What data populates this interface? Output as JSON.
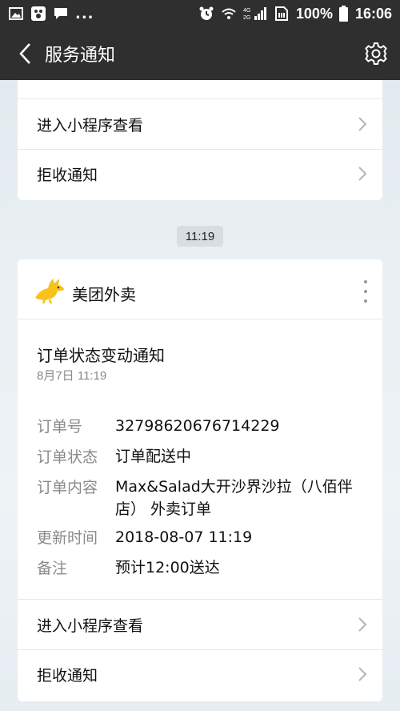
{
  "status_bar": {
    "battery_pct": "100%",
    "time": "16:06",
    "more": "...",
    "signal_label_4g": "4G",
    "signal_label_2g": "2G"
  },
  "app_bar": {
    "title": "服务通知"
  },
  "top_card": {
    "enter_label": "进入小程序查看",
    "reject_label": "拒收通知"
  },
  "timestamp": "11:19",
  "main_card": {
    "brand": "美团外卖",
    "title": "订单状态变动通知",
    "date": "8月7日  11:19",
    "fields": [
      {
        "label": "订单号",
        "value": "32798620676714229"
      },
      {
        "label": "订单状态",
        "value": "订单配送中"
      },
      {
        "label": "订单内容",
        "value": "Max&Salad大开沙界沙拉（八佰伴店） 外卖订单"
      },
      {
        "label": "更新时间",
        "value": "2018-08-07 11:19"
      },
      {
        "label": "备注",
        "value": "预计12:00送达"
      }
    ],
    "enter_label": "进入小程序查看",
    "reject_label": "拒收通知"
  },
  "colors": {
    "bar": "#2f2f2f",
    "brand_yellow": "#f6c21c",
    "label_gray": "#8a8a8a"
  }
}
